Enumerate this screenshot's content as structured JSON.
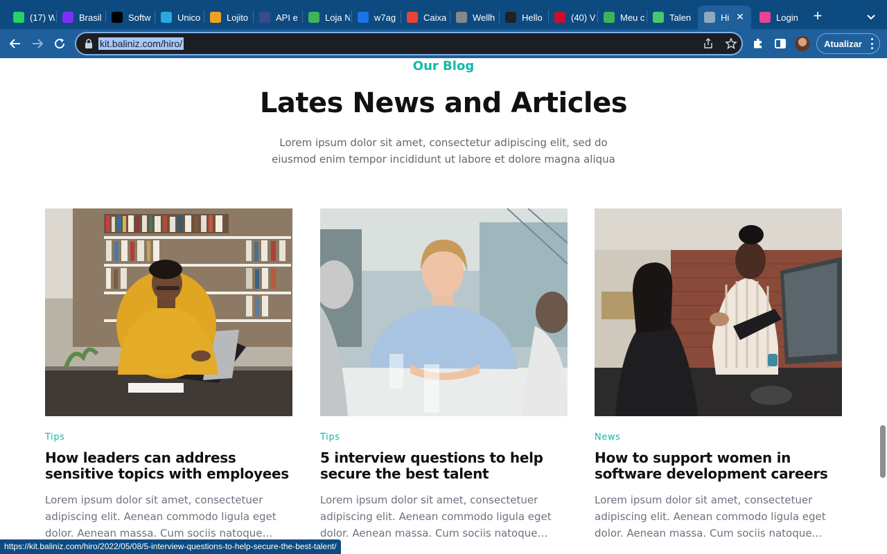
{
  "browser": {
    "tabs": [
      {
        "title": "(17) W",
        "icon": "whatsapp-icon",
        "color": "#25d366"
      },
      {
        "title": "Brasil",
        "icon": "play-icon",
        "color": "#7b2ff7"
      },
      {
        "title": "Softw",
        "icon": "h-logo-icon",
        "color": "#000000"
      },
      {
        "title": "Unico",
        "icon": "crosshair-icon",
        "color": "#2aa8e0"
      },
      {
        "title": "Lojito",
        "icon": "cart-icon",
        "color": "#f0a020"
      },
      {
        "title": "API e",
        "icon": "api-icon",
        "color": "#3a4a8a"
      },
      {
        "title": "Loja N",
        "icon": "leaf-icon",
        "color": "#3db45a"
      },
      {
        "title": "w7ag",
        "icon": "calendar-icon",
        "color": "#1a73e8"
      },
      {
        "title": "Caixa",
        "icon": "gmail-icon",
        "color": "#ea4335"
      },
      {
        "title": "Wellh",
        "icon": "globe-icon",
        "color": "#888888"
      },
      {
        "title": "Hello",
        "icon": "person-icon",
        "color": "#222222"
      },
      {
        "title": "(40) V",
        "icon": "w-logo-icon",
        "color": "#c8102e"
      },
      {
        "title": "Meu c",
        "icon": "leaf-icon",
        "color": "#3db45a"
      },
      {
        "title": "Talen",
        "icon": "z-logo-icon",
        "color": "#46c86e"
      },
      {
        "title": "Hi",
        "icon": "globe-icon",
        "color": "#8fa8c2",
        "active": true
      },
      {
        "title": "Login",
        "icon": "heart-icon",
        "color": "#e84393"
      }
    ],
    "url": "kit.baliniz.com/hiro/",
    "update_label": "Atualizar",
    "status_url": "https://kit.baliniz.com/hiro/2022/05/08/5-interview-questions-to-help-secure-the-best-talent/"
  },
  "section": {
    "kicker": "Our Blog",
    "heading": "Lates News and Articles",
    "intro": "Lorem ipsum dolor sit amet, consectetur adipiscing elit, sed do eiusmod enim tempor incididunt ut labore et dolore magna aliqua"
  },
  "posts": [
    {
      "category": "Tips",
      "title": "How leaders can address sensitive topics with employees",
      "excerpt": "Lorem ipsum dolor sit amet, consectetuer adipiscing elit. Aenean commodo ligula eget dolor. Aenean massa. Cum sociis natoque…"
    },
    {
      "category": "Tips",
      "title": "5 interview questions to help secure the best talent",
      "excerpt": "Lorem ipsum dolor sit amet, consectetuer adipiscing elit. Aenean commodo ligula eget dolor. Aenean massa. Cum sociis natoque…"
    },
    {
      "category": "News",
      "title": "How to support women in software development careers",
      "excerpt": "Lorem ipsum dolor sit amet, consectetuer adipiscing elit. Aenean commodo ligula eget dolor. Aenean massa. Cum sociis natoque…"
    }
  ],
  "colors": {
    "accent": "#14b8a6",
    "tabstrip": "#0d4a80",
    "toolbar": "#1e5f9c"
  }
}
